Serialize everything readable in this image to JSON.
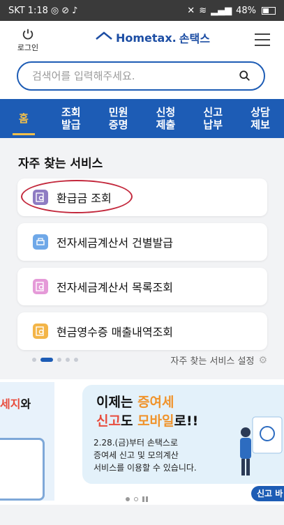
{
  "statusbar": {
    "carrier": "SKT",
    "time": "1:18",
    "battery": "48%"
  },
  "header": {
    "login_label": "로그인",
    "logo_text": "Hometax.",
    "logo_brand": "손택스"
  },
  "search": {
    "placeholder": "검색어를 입력해주세요."
  },
  "nav": {
    "tabs": [
      {
        "label": "홈",
        "active": true
      },
      {
        "label": "조회\n발급"
      },
      {
        "label": "민원\n증명"
      },
      {
        "label": "신청\n제출"
      },
      {
        "label": "신고\n납부"
      },
      {
        "label": "상담\n제보"
      }
    ]
  },
  "services": {
    "title": "자주 찾는 서비스",
    "items": [
      {
        "label": "환급금 조회",
        "icon": "search-document-icon",
        "color": "#8e7cc3"
      },
      {
        "label": "전자세금계산서 건별발급",
        "icon": "printer-icon",
        "color": "#6fa8e8"
      },
      {
        "label": "전자세금계산서 목록조회",
        "icon": "search-document-icon",
        "color": "#e59ad8"
      },
      {
        "label": "현금영수증 매출내역조회",
        "icon": "search-document-icon",
        "color": "#f3b548"
      }
    ],
    "settings_label": "자주 찾는 서비스 설정"
  },
  "banner": {
    "left_text_part": "세지",
    "left_text_suffix": "와",
    "title_line1_a": "이제는 ",
    "title_line1_b": "증여세",
    "title_line2_a": "신고",
    "title_line2_b": "도 ",
    "title_line2_c": "모바일",
    "title_line2_d": "로!!",
    "sub1": "2.28.(금)부터 손택스로",
    "sub2": "증여세 신고 및 모의계산",
    "sub3": "서비스를 이용할 수 있습니다.",
    "tag": "신고 바"
  },
  "colors": {
    "accent": "#1d5cb5",
    "active_tab": "#f3c04a",
    "highlight_circle": "#c3283c"
  }
}
